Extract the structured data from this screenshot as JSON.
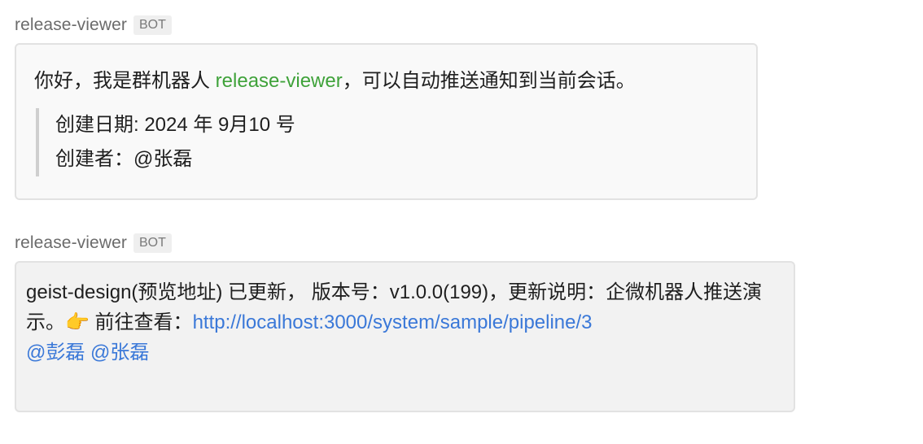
{
  "messages": [
    {
      "sender": "release-viewer",
      "badge": "BOT",
      "intro_prefix": "你好，我是群机器人 ",
      "bot_name": "release-viewer",
      "intro_suffix": "，可以自动推送通知到当前会话。",
      "created_date": "创建日期: 2024 年 9月10 号",
      "creator": "创建者：@张磊"
    },
    {
      "sender": "release-viewer",
      "badge": "BOT",
      "update_text": "geist-design(预览地址) 已更新， 版本号：v1.0.0(199)，更新说明：企微机器人推送演示。",
      "pointer_icon": "👉",
      "goto_label": " 前往查看：",
      "link": "http://localhost:3000/system/sample/pipeline/3",
      "mentions": [
        " @彭磊",
        " @张磊"
      ]
    }
  ],
  "colors": {
    "bot_name": "#3fa23a",
    "link": "#3a78d8",
    "sender": "#6b6b6b"
  }
}
